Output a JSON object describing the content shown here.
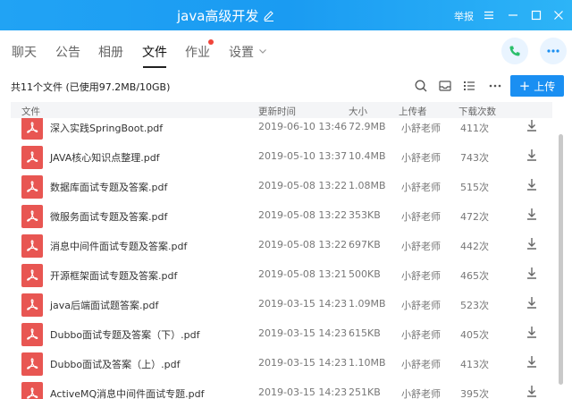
{
  "window": {
    "title": "java高级开发",
    "report": "举报"
  },
  "tabs": [
    {
      "label": "聊天"
    },
    {
      "label": "公告"
    },
    {
      "label": "相册"
    },
    {
      "label": "文件"
    },
    {
      "label": "作业"
    },
    {
      "label": "设置"
    }
  ],
  "toolbar": {
    "summary": "共11个文件 (已使用97.2MB/10GB)",
    "upload_label": "上传"
  },
  "table": {
    "headers": {
      "file": "文件",
      "time": "更新时间",
      "size": "大小",
      "uploader": "上传者",
      "count": "下载次数"
    },
    "rows": [
      {
        "name": "深入实践SpringBoot.pdf",
        "time": "2019-06-10 13:46",
        "size": "72.9MB",
        "uploader": "小舒老师",
        "count": "411次"
      },
      {
        "name": "JAVA核心知识点整理.pdf",
        "time": "2019-05-10 13:37",
        "size": "10.4MB",
        "uploader": "小舒老师",
        "count": "743次"
      },
      {
        "name": "数据库面试专题及答案.pdf",
        "time": "2019-05-08 13:22",
        "size": "1.08MB",
        "uploader": "小舒老师",
        "count": "515次"
      },
      {
        "name": "微服务面试专题及答案.pdf",
        "time": "2019-05-08 13:22",
        "size": "353KB",
        "uploader": "小舒老师",
        "count": "472次"
      },
      {
        "name": "消息中间件面试专题及答案.pdf",
        "time": "2019-05-08 13:22",
        "size": "697KB",
        "uploader": "小舒老师",
        "count": "442次"
      },
      {
        "name": "开源框架面试专题及答案.pdf",
        "time": "2019-05-08 13:21",
        "size": "500KB",
        "uploader": "小舒老师",
        "count": "465次"
      },
      {
        "name": "java后端面试题答案.pdf",
        "time": "2019-03-15 14:23",
        "size": "1.09MB",
        "uploader": "小舒老师",
        "count": "523次"
      },
      {
        "name": "Dubbo面试专题及答案（下）.pdf",
        "time": "2019-03-15 14:23",
        "size": "615KB",
        "uploader": "小舒老师",
        "count": "405次"
      },
      {
        "name": "Dubbo面试及答案（上）.pdf",
        "time": "2019-03-15 14:23",
        "size": "1.10MB",
        "uploader": "小舒老师",
        "count": "413次"
      },
      {
        "name": "ActiveMQ消息中间件面试专题.pdf",
        "time": "2019-03-15 14:23",
        "size": "251KB",
        "uploader": "小舒老师",
        "count": "395次"
      }
    ]
  },
  "colors": {
    "titlebar": "#1a9bf2",
    "accent": "#1a8ff2",
    "pdf_icon": "#e85652",
    "notification_dot": "#f0443a",
    "phone_icon": "#2bbf6b"
  }
}
